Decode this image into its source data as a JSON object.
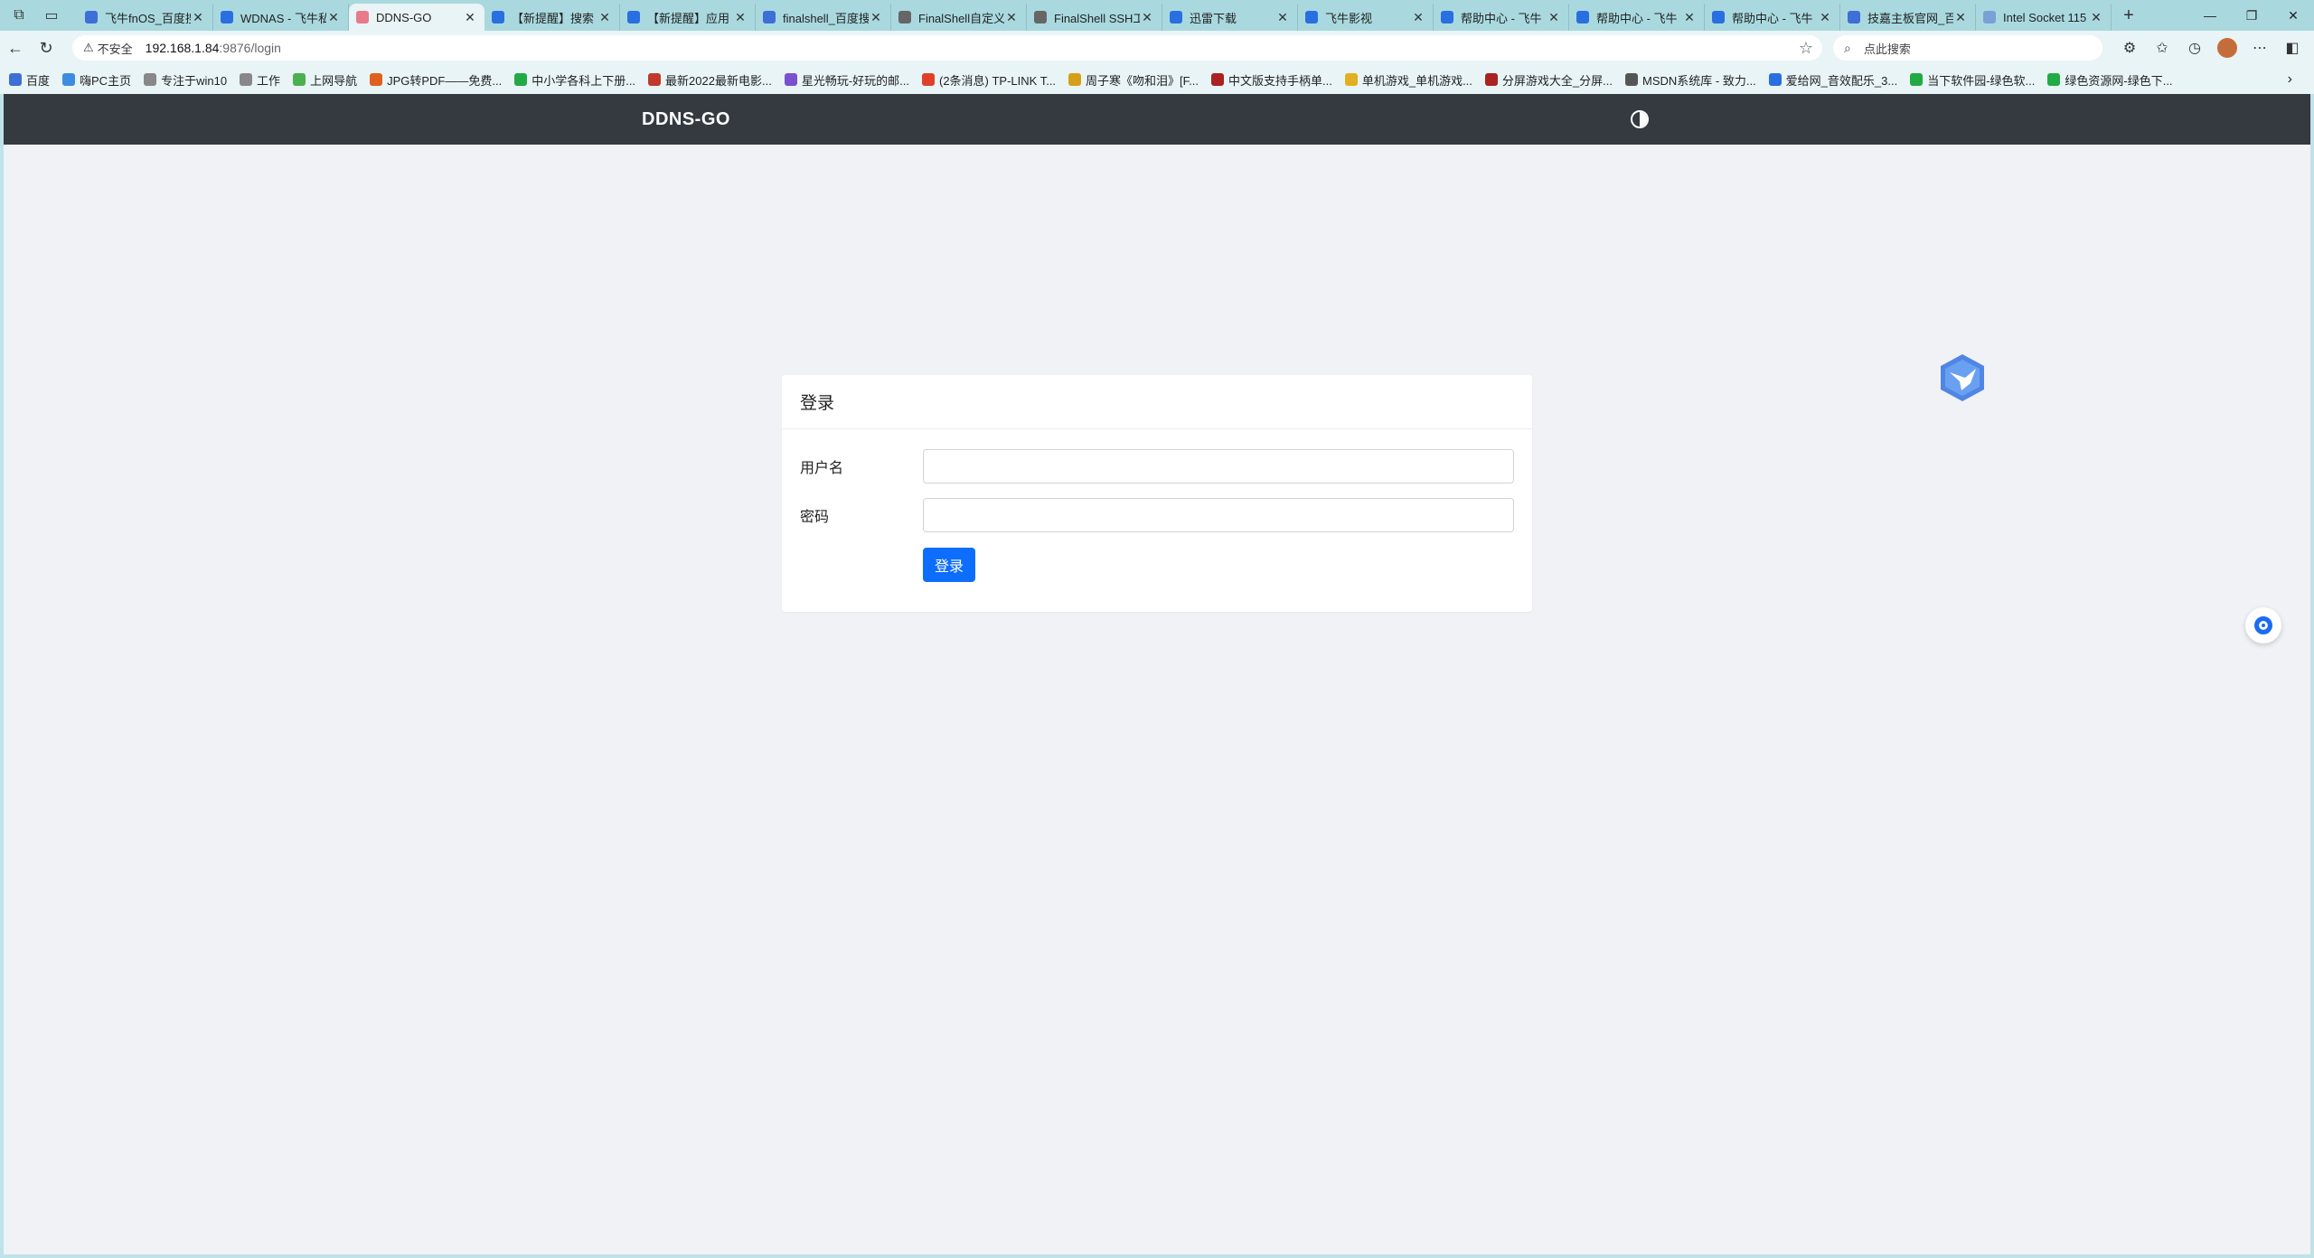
{
  "browser": {
    "tabs": [
      {
        "title": "飞牛fnOS_百度搜",
        "color": "#3d6fd6",
        "active": false
      },
      {
        "title": "WDNAS - 飞牛私",
        "color": "#2a6fe0",
        "active": false
      },
      {
        "title": "DDNS-GO",
        "color": "#e87a8a",
        "active": true
      },
      {
        "title": "【新提醒】搜索",
        "color": "#2a6fe0",
        "active": false
      },
      {
        "title": "【新提醒】应用",
        "color": "#2a6fe0",
        "active": false
      },
      {
        "title": "finalshell_百度搜",
        "color": "#3d6fd6",
        "active": false
      },
      {
        "title": "FinalShell自定义",
        "color": "#666666",
        "active": false
      },
      {
        "title": "FinalShell SSH工",
        "color": "#666666",
        "active": false
      },
      {
        "title": "迅雷下载",
        "color": "#2a6fe0",
        "active": false
      },
      {
        "title": "飞牛影视",
        "color": "#2a6fe0",
        "active": false
      },
      {
        "title": "帮助中心 - 飞牛",
        "color": "#2a6fe0",
        "active": false
      },
      {
        "title": "帮助中心 - 飞牛",
        "color": "#2a6fe0",
        "active": false
      },
      {
        "title": "帮助中心 - 飞牛",
        "color": "#2a6fe0",
        "active": false
      },
      {
        "title": "技嘉主板官网_百",
        "color": "#3d6fd6",
        "active": false
      },
      {
        "title": "Intel Socket 115",
        "color": "#7aa0d8",
        "active": false
      }
    ],
    "address": {
      "insecure_label": "不安全",
      "url_host": "192.168.1.84",
      "url_path": ":9876/login"
    },
    "search_placeholder": "点此搜索",
    "bookmarks": [
      {
        "label": "百度",
        "color": "#3d6fd6"
      },
      {
        "label": "嗨PC主页",
        "color": "#3d8ce0"
      },
      {
        "label": "专注于win10",
        "color": "#888888"
      },
      {
        "label": "工作",
        "color": "#888888"
      },
      {
        "label": "上网导航",
        "color": "#4caf50"
      },
      {
        "label": "JPG转PDF——免费...",
        "color": "#e06020"
      },
      {
        "label": "中小学各科上下册...",
        "color": "#22aa44"
      },
      {
        "label": "最新2022最新电影...",
        "color": "#c0392b"
      },
      {
        "label": "星光畅玩-好玩的邮...",
        "color": "#7a4fd0"
      },
      {
        "label": "(2条消息) TP-LINK T...",
        "color": "#e0402a"
      },
      {
        "label": "周子寒《吻和泪》[F...",
        "color": "#d4a017"
      },
      {
        "label": "中文版支持手柄单...",
        "color": "#aa2222"
      },
      {
        "label": "单机游戏_单机游戏...",
        "color": "#e0b020"
      },
      {
        "label": "分屏游戏大全_分屏...",
        "color": "#aa2222"
      },
      {
        "label": "MSDN系统库 - 致力...",
        "color": "#555555"
      },
      {
        "label": "爱给网_音效配乐_3...",
        "color": "#2a6fe0"
      },
      {
        "label": "当下软件园-绿色软...",
        "color": "#22aa44"
      },
      {
        "label": "绿色资源网-绿色下...",
        "color": "#22aa44"
      }
    ]
  },
  "page": {
    "brand": "DDNS-GO",
    "login": {
      "title": "登录",
      "username_label": "用户名",
      "password_label": "密码",
      "username_value": "",
      "password_value": "",
      "submit_label": "登录"
    }
  },
  "colors": {
    "navbar": "#343a40",
    "primary": "#0d6efd",
    "page_bg": "#f0f2f5"
  }
}
